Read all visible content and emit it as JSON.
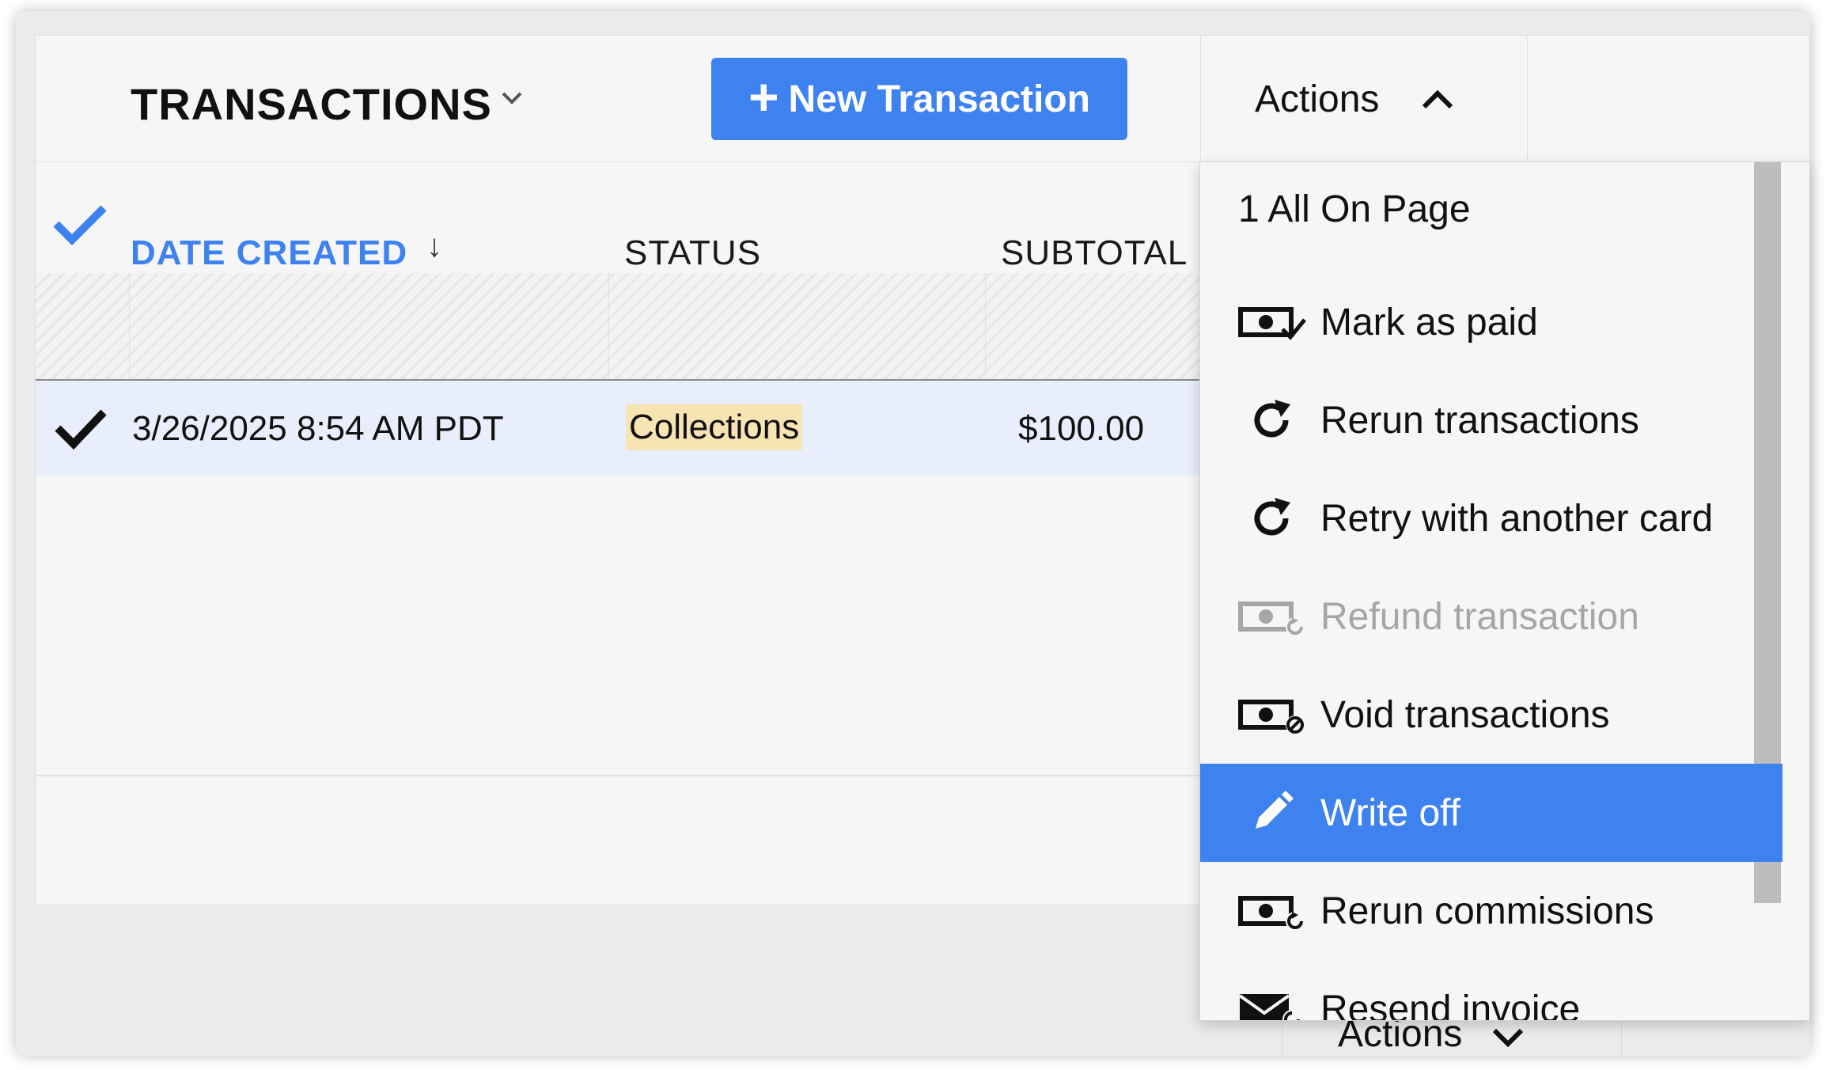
{
  "header": {
    "title": "TRANSACTIONS",
    "new_button": "New Transaction",
    "actions_label": "Actions"
  },
  "columns": {
    "date_created": "DATE CREATED",
    "sort_indicator": "↓",
    "status": "STATUS",
    "subtotal": "SUBTOTAL"
  },
  "row": {
    "date": "3/26/2025 8:54 AM PDT",
    "status": "Collections",
    "subtotal": "$100.00"
  },
  "dropdown": {
    "header": "1 All On Page",
    "items": [
      {
        "label": "Mark as paid",
        "icon": "money-check-icon"
      },
      {
        "label": "Rerun transactions",
        "icon": "refresh-icon"
      },
      {
        "label": "Retry with another card",
        "icon": "refresh-icon"
      },
      {
        "label": "Refund transaction",
        "icon": "money-refund-icon",
        "disabled": true
      },
      {
        "label": "Void transactions",
        "icon": "money-void-icon"
      },
      {
        "label": "Write off",
        "icon": "pencil-icon",
        "selected": true
      },
      {
        "label": "Rerun commissions",
        "icon": "money-rerun-icon"
      },
      {
        "label": "Resend invoice",
        "icon": "envelope-icon"
      }
    ]
  },
  "bottom_actions_label": "Actions",
  "colors": {
    "accent": "#3e82f0",
    "status_bg": "#f8e3b3",
    "status_text": "#b5521a",
    "disabled_text": "#a6a6a6"
  }
}
